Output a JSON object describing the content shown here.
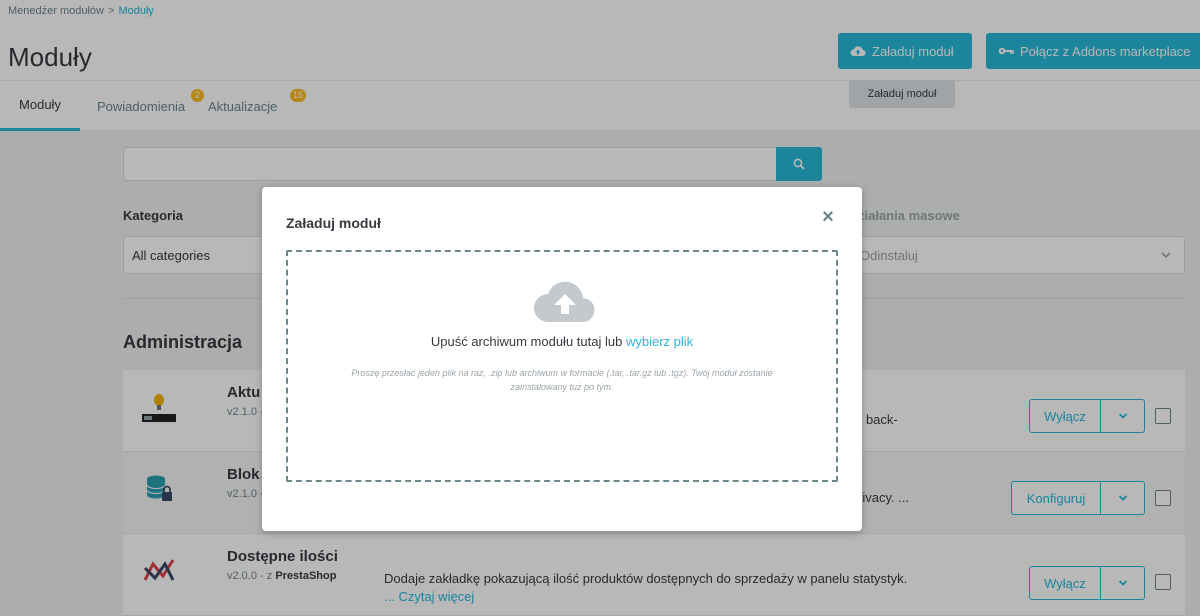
{
  "breadcrumb": {
    "parent": "Menedżer modułów",
    "separator": ">",
    "current": "Moduły"
  },
  "page_title": "Moduły",
  "header_buttons": {
    "upload": "Załaduj moduł",
    "connect": "Połącz z Addons marketplace"
  },
  "tooltip": "Załaduj moduł",
  "tabs": [
    {
      "label": "Moduły",
      "active": true
    },
    {
      "label": "Powiadomienia",
      "badge": "2"
    },
    {
      "label": "Aktualizacje",
      "badge": "15"
    }
  ],
  "search": {
    "value": "",
    "placeholder": ""
  },
  "filters": {
    "category_label": "Kategoria",
    "category_value": "All categories",
    "bulk_label": "ziałania masowe",
    "bulk_value": "Odinstaluj"
  },
  "section_title": "Administracja",
  "modules": [
    {
      "name": "Aktu",
      "version": "v2.1.0 -",
      "desc_fragment": "r back-",
      "action": "Wyłącz"
    },
    {
      "name": "Blok",
      "version": "v2.1.0 -",
      "desc_fragment": "rivacy. ...",
      "action": "Konfiguruj"
    },
    {
      "name": "Dostępne ilości",
      "version": "v2.0.0 - z",
      "author": "PrestaShop",
      "description": "Dodaje zakładkę pokazującą ilość produktów dostępnych do sprzedaży w panelu statystyk.",
      "read_more": "... Czytaj więcej",
      "action": "Wyłącz"
    }
  ],
  "modal": {
    "title": "Załaduj moduł",
    "close": "×",
    "drop_text": "Upuść archiwum modułu tutaj lub",
    "drop_link": "wybierz plik",
    "hint": "Proszę przesłać jeden plik na raz, .zip lub archiwum w formacie (.tar, .tar.gz lub .tgz). Twój moduł zostanie zainstalowany tuż po tym."
  },
  "colors": {
    "accent": "#25b9d7",
    "badge": "#fbbb22",
    "text": "#363a41",
    "muted": "#6c868e"
  }
}
